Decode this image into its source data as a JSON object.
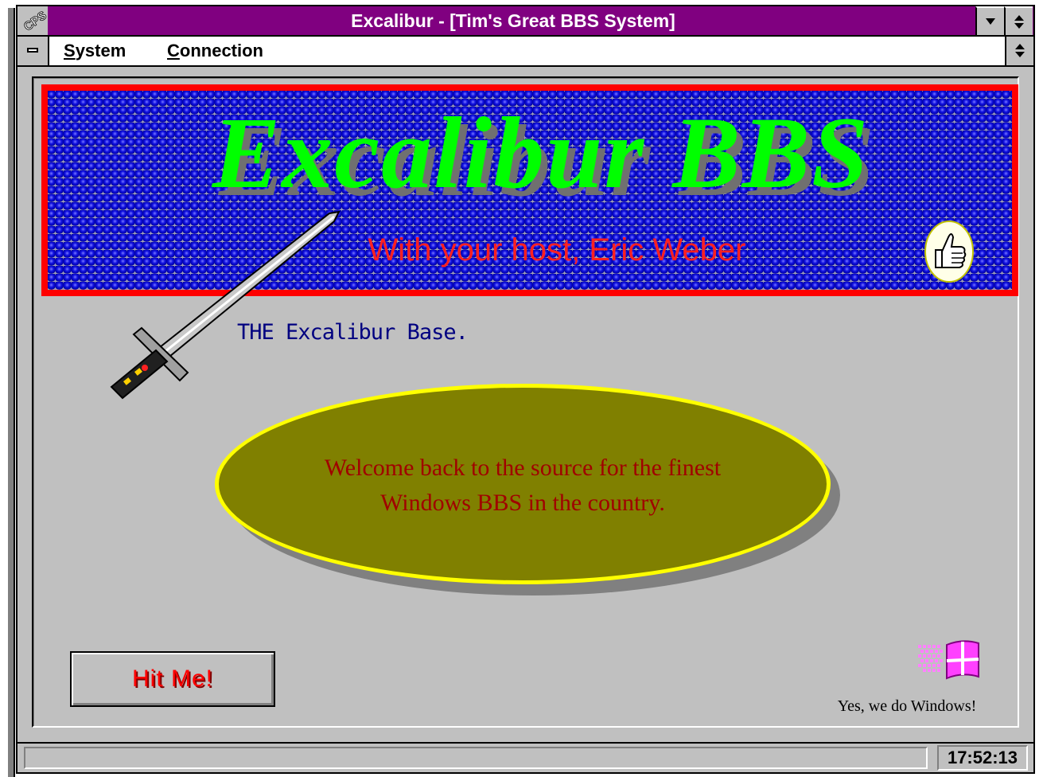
{
  "window": {
    "title": "Excalibur - [Tim's Great BBS System]",
    "app_icon": "cps-icon"
  },
  "menu": {
    "items": [
      {
        "label": "System",
        "accel": "S",
        "rest": "ystem"
      },
      {
        "label": "Connection",
        "accel": "C",
        "rest": "onnection"
      }
    ]
  },
  "banner": {
    "title": "Excalibur BBS",
    "subtitle": "With your host, Eric Weber",
    "colors": {
      "border": "#ff0000",
      "title": "#00ff00",
      "subtitle": "#ff2020",
      "dots": "#0000c0"
    }
  },
  "main": {
    "base_text": "THE Excalibur Base.",
    "welcome_line1": "Welcome back to the source for the finest",
    "welcome_line2": "Windows BBS in the country.",
    "hit_button": "Hit Me!",
    "windows_caption": "Yes, we do Windows!"
  },
  "status": {
    "clock": "17:52:13"
  },
  "colors": {
    "titlebar": "#800080",
    "client": "#c0c0c0",
    "ellipse_fill": "#808000",
    "ellipse_border": "#ffff00",
    "welcome_text": "#a00000",
    "base_text": "#000080"
  }
}
